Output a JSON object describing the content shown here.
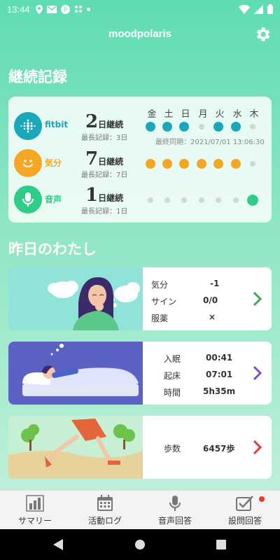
{
  "status_bar": {
    "time": "13:44"
  },
  "app": {
    "title": "moodpolaris"
  },
  "streak_section": {
    "title": "継続記録",
    "days": [
      "金",
      "土",
      "日",
      "月",
      "火",
      "水",
      "木"
    ],
    "rows": [
      {
        "label": "fitbit",
        "count": "2",
        "unit": "日継続",
        "best": "最長記録：3日",
        "color": "#1aa7b8",
        "filled": [
          true,
          true,
          true,
          false,
          true,
          true,
          false
        ]
      },
      {
        "label": "気分",
        "count": "7",
        "unit": "日継続",
        "best": "最長記録：7日",
        "color": "#f5a623",
        "filled": [
          true,
          true,
          true,
          true,
          true,
          true,
          false
        ]
      },
      {
        "label": "音声",
        "count": "1",
        "unit": "日継続",
        "best": "最長記録：1日",
        "color": "#2ecc87",
        "filled": [
          false,
          false,
          false,
          false,
          false,
          false,
          true
        ]
      }
    ],
    "last_sync": "最終同期：2021/07/01 13:06:30"
  },
  "yesterday_section": {
    "title": "昨日のわたし",
    "mood_card": {
      "rows": [
        {
          "label": "気分",
          "value": "-1"
        },
        {
          "label": "サイン",
          "value": "0/0"
        },
        {
          "label": "服薬",
          "value": "×"
        }
      ],
      "chevron_color": "#3aa84c"
    },
    "sleep_card": {
      "rows": [
        {
          "label": "入眠",
          "value": "00:41"
        },
        {
          "label": "起床",
          "value": "07:01"
        },
        {
          "label": "時間",
          "value": "5h35m"
        }
      ],
      "chevron_color": "#7b4ddb"
    },
    "steps_card": {
      "rows": [
        {
          "label": "歩数",
          "value": "6457歩"
        }
      ],
      "chevron_color": "#e53935"
    }
  },
  "bottom_nav": {
    "items": [
      {
        "label": "サマリー",
        "icon": "bar-chart-icon"
      },
      {
        "label": "活動ログ",
        "icon": "calendar-icon"
      },
      {
        "label": "音声回答",
        "icon": "microphone-icon"
      },
      {
        "label": "設問回答",
        "icon": "checkbox-edit-icon"
      }
    ]
  }
}
